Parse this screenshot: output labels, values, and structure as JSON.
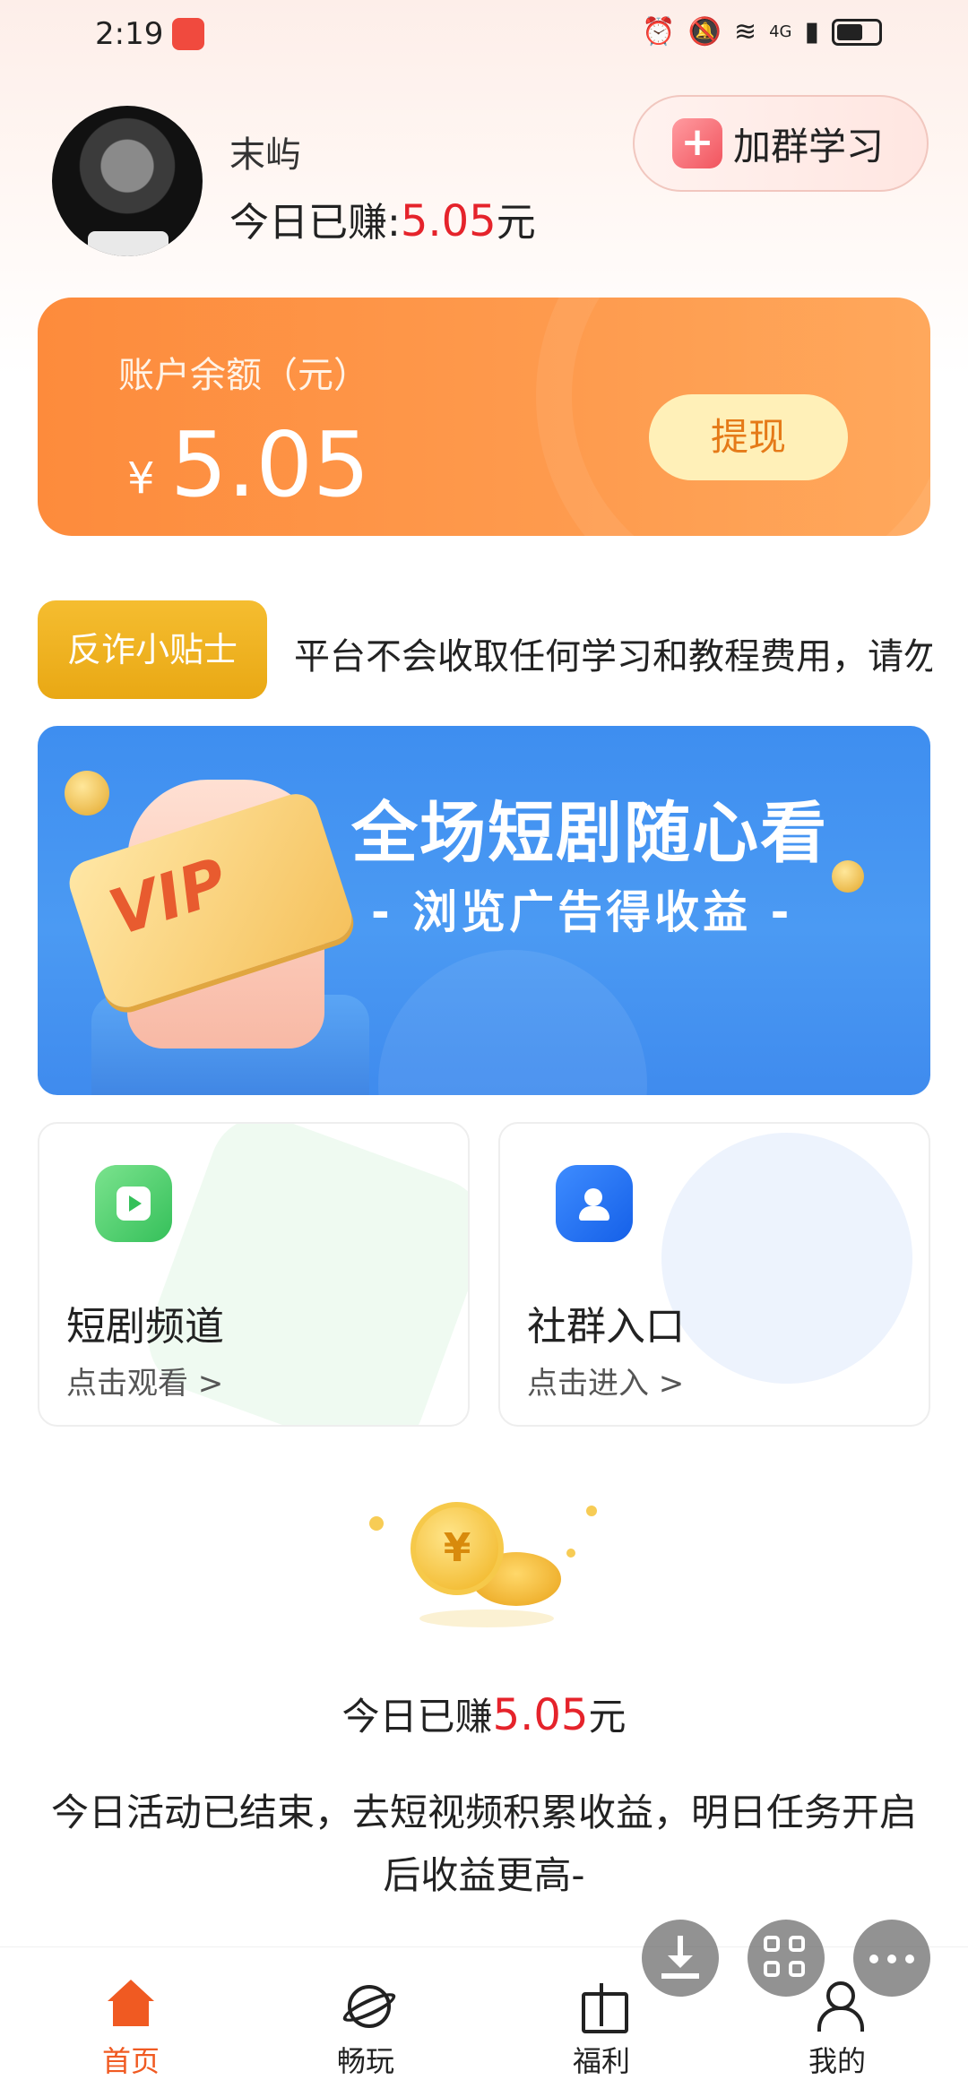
{
  "status_bar": {
    "time": "2:19",
    "network": "4G"
  },
  "header": {
    "user_name": "末屿",
    "today_earned_prefix": "今日已赚:",
    "today_earned_amount": "5.05",
    "today_earned_unit": "元",
    "join_group_label": "加群学习"
  },
  "balance": {
    "label": "账户余额（元）",
    "currency": "¥",
    "value": "5.05",
    "withdraw_label": "提现"
  },
  "tips": {
    "badge": "反诈小贴士",
    "text": "平台不会收取任何学习和教程费用，请勿"
  },
  "banner": {
    "card_text": "VIP",
    "title": "全场短剧随心看",
    "subtitle": "- 浏览广告得收益 -"
  },
  "features": [
    {
      "title": "短剧频道",
      "subtitle": "点击观看 >",
      "icon": "play-icon"
    },
    {
      "title": "社群入口",
      "subtitle": "点击进入 >",
      "icon": "group-icon"
    }
  ],
  "summary": {
    "prefix": "今日已赚",
    "amount": "5.05",
    "unit": "元",
    "notice": "今日活动已结束，去短视频积累收益，明日任务开启后收益更高-"
  },
  "coin_symbol": "¥",
  "bottom_nav": [
    {
      "label": "首页",
      "icon": "home-icon",
      "active": true
    },
    {
      "label": "畅玩",
      "icon": "planet-icon",
      "active": false
    },
    {
      "label": "福利",
      "icon": "gift-icon",
      "active": false
    },
    {
      "label": "我的",
      "icon": "user-icon",
      "active": false
    }
  ],
  "colors": {
    "accent_orange": "#f05a22",
    "balance_card": "#fd8b3c",
    "earn_red": "#e5232b",
    "banner_blue": "#3e8ef0",
    "tips_yellow": "#f5bd30"
  }
}
